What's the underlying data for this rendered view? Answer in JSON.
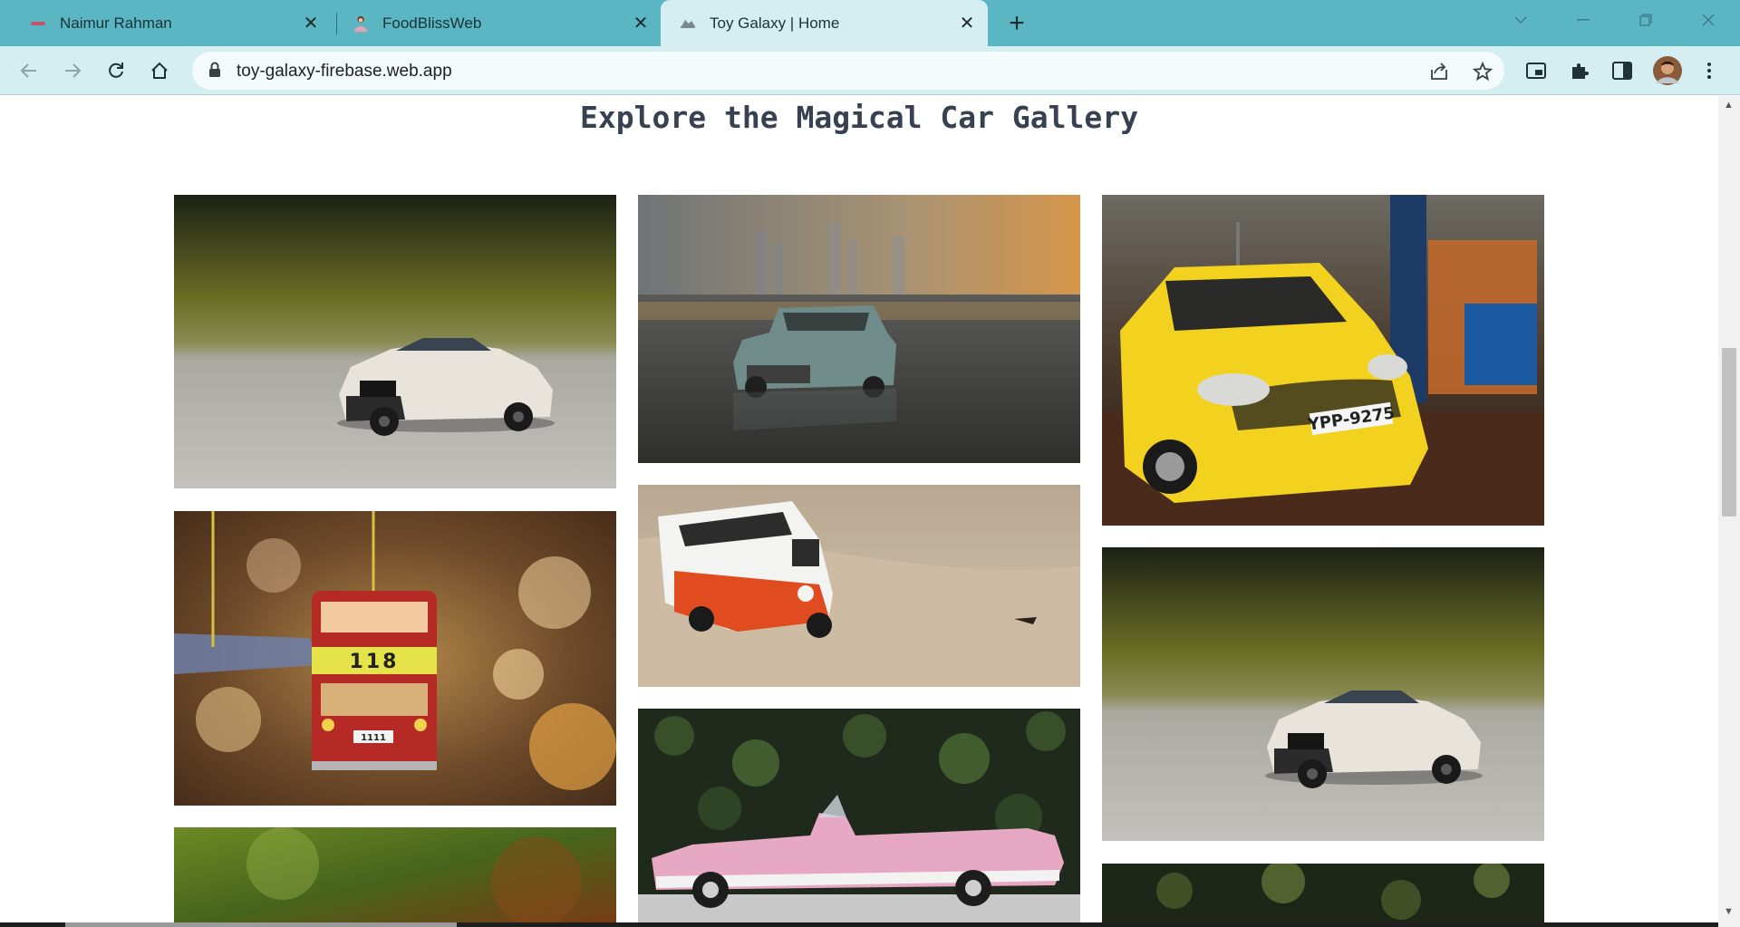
{
  "browser": {
    "tabs": [
      {
        "title": "Naimur Rahman",
        "favicon": "red-dash-icon",
        "active": false
      },
      {
        "title": "FoodBlissWeb",
        "favicon": "person-icon",
        "active": false
      },
      {
        "title": "Toy Galaxy | Home",
        "favicon": "toy-galaxy-icon",
        "active": true
      }
    ],
    "url": "toy-galaxy-firebase.web.app",
    "accent": "#5ab6c2",
    "toolbar_bg": "#d4eef1"
  },
  "page": {
    "heading": "Explore the Magical Car Gallery",
    "gallery": [
      {
        "subject": "white lego sports car on grey road, olive bokeh background"
      },
      {
        "subject": "vintage blue toy car on wet beach at sunset"
      },
      {
        "subject": "yellow hatchback with plate YPP-9275 at gas station",
        "plate": "YPP-9275"
      },
      {
        "subject": "red double-decker toy bus ornament 118",
        "route": "118",
        "plate": "1111"
      },
      {
        "subject": "red and white toy van on sand"
      },
      {
        "subject": "white lego sports car on grey road, olive bokeh background"
      },
      {
        "subject": "green bokeh toy car photo (cropped)"
      },
      {
        "subject": "pink classic convertible toy car with ivy background"
      },
      {
        "subject": "dark green leaves toy car photo (cropped)"
      }
    ]
  }
}
